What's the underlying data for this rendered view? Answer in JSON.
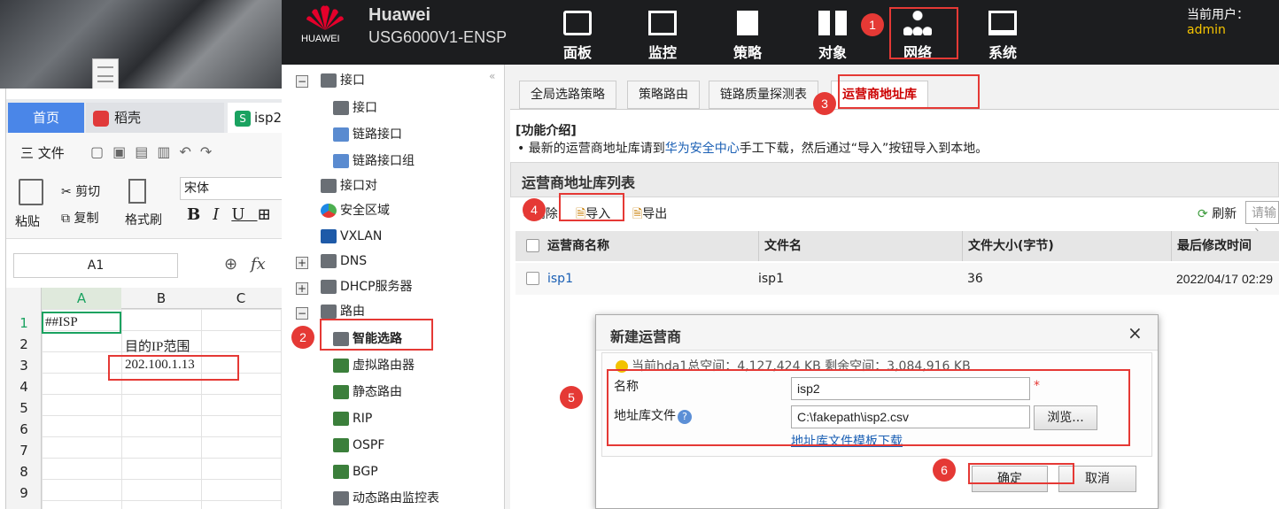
{
  "wps": {
    "tabs": [
      "首页",
      "稻壳",
      "isp2"
    ],
    "menu_file": "三 文件",
    "clip": {
      "paste": "粘贴",
      "cut": "剪切",
      "copy": "复制",
      "format_painter": "格式刷"
    },
    "font_name": "宋体",
    "name_box": "A1",
    "fx": "fx",
    "columns": [
      "A",
      "B",
      "C"
    ],
    "rows": [
      "1",
      "2",
      "3",
      "4",
      "5",
      "6",
      "7",
      "8",
      "9"
    ],
    "cells": {
      "a1": "##ISP",
      "b2": "目的IP范围",
      "b3": "202.100.1.13"
    }
  },
  "huawei": {
    "brand": "HUAWEI",
    "title1": "Huawei",
    "title2": "USG6000V1-ENSP",
    "user_label": "当前用户：",
    "user": "admin",
    "nav": [
      "面板",
      "监控",
      "策略",
      "对象",
      "网络",
      "系统"
    ],
    "sidebar": [
      {
        "label": "接口"
      },
      {
        "label": "接口"
      },
      {
        "label": "链路接口"
      },
      {
        "label": "链路接口组"
      },
      {
        "label": "接口对"
      },
      {
        "label": "安全区域"
      },
      {
        "label": "VXLAN"
      },
      {
        "label": "DNS"
      },
      {
        "label": "DHCP服务器"
      },
      {
        "label": "路由"
      },
      {
        "label": "智能选路"
      },
      {
        "label": "虚拟路由器"
      },
      {
        "label": "静态路由"
      },
      {
        "label": "RIP"
      },
      {
        "label": "OSPF"
      },
      {
        "label": "BGP"
      },
      {
        "label": "动态路由监控表"
      }
    ],
    "tabs": [
      "全局选路策略",
      "策略路由",
      "链路质量探测表",
      "运营商地址库"
    ],
    "intro_title": "[功能介绍]",
    "intro_pre": "最新的运营商地址库请到",
    "intro_link": "华为安全中心",
    "intro_post": "手工下载，然后通过“导入”按钮导入到本地。",
    "list_title": "运营商地址库列表",
    "toolbar": {
      "delete": "删除",
      "import": "导入",
      "export": "导出",
      "refresh": "刷新",
      "search_placeholder": "请输入"
    },
    "table": {
      "headers": [
        "运营商名称",
        "文件名",
        "文件大小(字节)",
        "最后修改时间"
      ],
      "rows": [
        [
          "isp1",
          "isp1",
          "36",
          "2022/04/17 02:29"
        ]
      ]
    }
  },
  "dialog": {
    "title": "新建运营商",
    "close": "×",
    "space": "当前hda1总空间：4,127,424 KB    剩余空间：3,084,916 KB",
    "name_label": "名称",
    "name_value": "isp2",
    "required": "*",
    "file_label": "地址库文件",
    "file_value": "C:\\fakepath\\isp2.csv",
    "browse": "浏览...",
    "template_link": "地址库文件模板下载",
    "ok": "确定",
    "cancel": "取消"
  },
  "annotations": [
    "1",
    "2",
    "3",
    "4",
    "5",
    "6"
  ],
  "colors": {
    "annotation": "#e53935",
    "link": "#1a5fb4",
    "header_bg": "#1c1d1f"
  }
}
